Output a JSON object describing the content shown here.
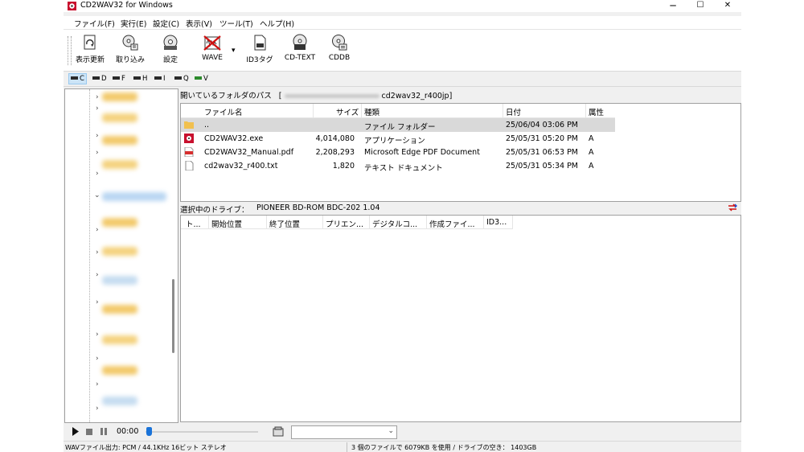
{
  "window": {
    "title": "CD2WAV32 for Windows",
    "minimize": "─",
    "maximize": "☐",
    "close": "✕"
  },
  "menu": [
    "ファイル(F)",
    "実行(E)",
    "設定(C)",
    "表示(V)",
    "ツール(T)",
    "ヘルプ(H)"
  ],
  "toolbar": {
    "refresh": "表示更新",
    "import": "取り込み",
    "settings": "設定",
    "wave": "WAVE",
    "dropdown": "▾",
    "id3": "ID3タグ",
    "cdtext": "CD-TEXT",
    "cddb": "CDDB"
  },
  "drives": [
    "C",
    "D",
    "F",
    "H",
    "I",
    "Q",
    "V"
  ],
  "path_bar": {
    "label": "開いているフォルダのパス",
    "open_bracket": "[",
    "value": "cd2wav32_r400jp]"
  },
  "file_list": {
    "columns": [
      "ファイル名",
      "サイズ",
      "種類",
      "日付",
      "属性"
    ],
    "rows": [
      {
        "name": "..",
        "size": "",
        "type": "ファイル フォルダー",
        "date": "25/06/04 03:06 PM",
        "attr": "",
        "icon": "folder-icon"
      },
      {
        "name": "CD2WAV32.exe",
        "size": "4,014,080",
        "type": "アプリケーション",
        "date": "25/05/31 05:20 PM",
        "attr": "A",
        "icon": "exe-icon"
      },
      {
        "name": "CD2WAV32_Manual.pdf",
        "size": "2,208,293",
        "type": "Microsoft Edge PDF Document",
        "date": "25/05/31 06:53 PM",
        "attr": "A",
        "icon": "pdf-icon"
      },
      {
        "name": "cd2wav32_r400.txt",
        "size": "1,820",
        "type": "テキスト ドキュメント",
        "date": "25/05/31 05:34 PM",
        "attr": "A",
        "icon": "text-file-icon"
      }
    ]
  },
  "drive_info": {
    "label": "選択中のドライブ：",
    "value": "PIONEER BD-ROM  BDC-202 1.04"
  },
  "track_list": {
    "columns": [
      "ト...",
      "開始位置",
      "終了位置",
      "プリエン...",
      "デジタルコ...",
      "作成ファイ...",
      "ID3..."
    ]
  },
  "player": {
    "time": "00:00",
    "progress": 0
  },
  "status": {
    "left": "WAVファイル出力: PCM / 44.1KHz 16ビット ステレオ",
    "right": "3 個のファイルで 6079KB を使用 / ドライブの空き： 1403GB"
  },
  "colors": {
    "selection": "#cce4f7",
    "seek_thumb": "#1a73d9",
    "row_highlight": "#d9d9d9"
  }
}
